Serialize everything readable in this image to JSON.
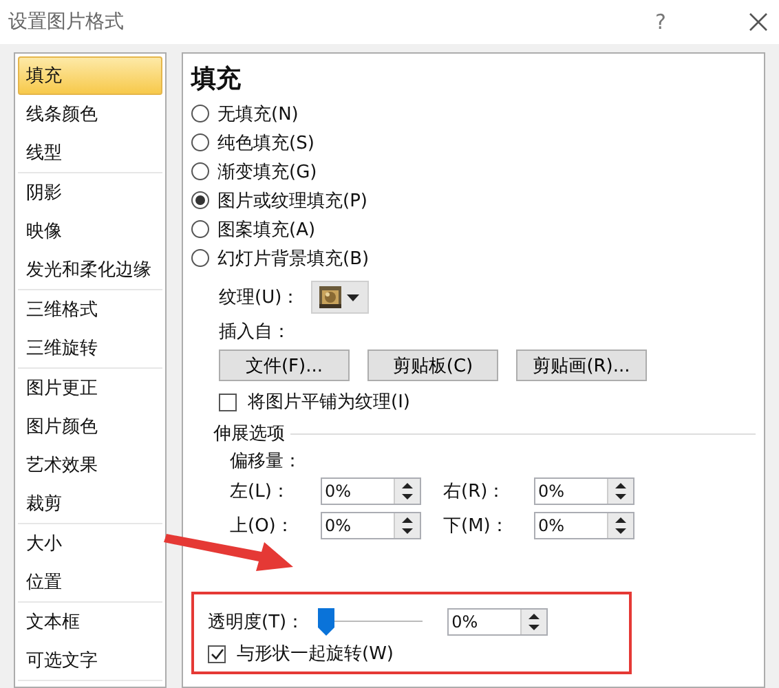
{
  "window": {
    "title": "设置图片格式",
    "help": "?"
  },
  "sidebar": {
    "groups": [
      {
        "items": [
          {
            "label": "填充",
            "selected": true
          },
          {
            "label": "线条颜色",
            "selected": false
          },
          {
            "label": "线型",
            "selected": false
          }
        ]
      },
      {
        "items": [
          {
            "label": "阴影",
            "selected": false
          },
          {
            "label": "映像",
            "selected": false
          },
          {
            "label": "发光和柔化边缘",
            "selected": false
          }
        ]
      },
      {
        "items": [
          {
            "label": "三维格式",
            "selected": false
          },
          {
            "label": "三维旋转",
            "selected": false
          }
        ]
      },
      {
        "items": [
          {
            "label": "图片更正",
            "selected": false
          },
          {
            "label": "图片颜色",
            "selected": false
          },
          {
            "label": "艺术效果",
            "selected": false
          },
          {
            "label": "裁剪",
            "selected": false
          }
        ]
      },
      {
        "items": [
          {
            "label": "大小",
            "selected": false
          },
          {
            "label": "位置",
            "selected": false
          }
        ]
      },
      {
        "items": [
          {
            "label": "文本框",
            "selected": false
          },
          {
            "label": "可选文字",
            "selected": false
          }
        ]
      }
    ]
  },
  "panel": {
    "heading": "填充",
    "fill_options": [
      {
        "label": "无填充(N)",
        "selected": false
      },
      {
        "label": "纯色填充(S)",
        "selected": false
      },
      {
        "label": "渐变填充(G)",
        "selected": false
      },
      {
        "label": "图片或纹理填充(P)",
        "selected": true
      },
      {
        "label": "图案填充(A)",
        "selected": false
      },
      {
        "label": "幻灯片背景填充(B)",
        "selected": false
      }
    ],
    "texture": {
      "label": "纹理(U)："
    },
    "insert_from": "插入自：",
    "buttons": [
      "文件(F)...",
      "剪贴板(C)",
      "剪贴画(R)..."
    ],
    "tile_checkbox": {
      "label": "将图片平铺为纹理(I)",
      "checked": false
    },
    "stretch_options": "伸展选项",
    "offset_label": "偏移量：",
    "offsets": [
      {
        "label": "左(L)：",
        "value": "0%"
      },
      {
        "label": "右(R)：",
        "value": "0%"
      },
      {
        "label": "上(O)：",
        "value": "0%"
      },
      {
        "label": "下(M)：",
        "value": "0%"
      }
    ],
    "transparency": {
      "label": "透明度(T)：",
      "level": 0,
      "value": "0%"
    },
    "rotate_checkbox": {
      "label": "与形状一起旋转(W)",
      "checked": true
    }
  }
}
